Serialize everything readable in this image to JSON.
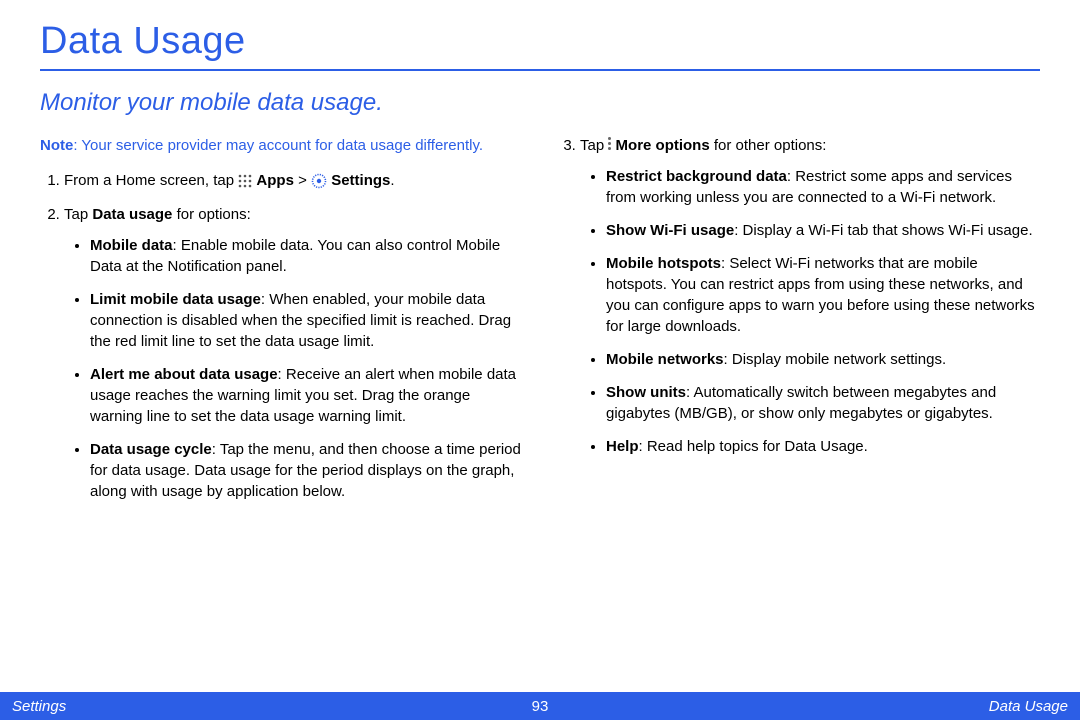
{
  "title": "Data Usage",
  "subtitle": "Monitor your mobile data usage.",
  "note_label": "Note",
  "note_text": ": Your service provider may account for data usage differently.",
  "step1_pre": "From a Home screen, tap ",
  "step1_apps": "Apps",
  "step1_gt": " > ",
  "step1_settings": "Settings",
  "step1_end": ".",
  "step2_pre": "Tap ",
  "step2_bold": "Data usage",
  "step2_post": " for options:",
  "left_items": [
    {
      "bold": "Mobile data",
      "rest": ": Enable mobile data. You can also control Mobile Data at the Notification panel."
    },
    {
      "bold": "Limit mobile data usage",
      "rest": ": When enabled, your mobile data connection is disabled when the specified limit is reached. Drag the red limit line to set the data usage limit."
    },
    {
      "bold": "Alert me about data usage",
      "rest": ": Receive an alert when mobile data usage reaches the warning limit you set. Drag the orange warning line to set the data usage warning limit."
    },
    {
      "bold": "Data usage cycle",
      "rest": ": Tap the menu, and then choose a time period for data usage. Data usage for the period displays on the graph, along with usage by application below."
    }
  ],
  "step3_pre": "Tap ",
  "step3_bold": "More options",
  "step3_post": " for other options:",
  "right_items": [
    {
      "bold": "Restrict background data",
      "rest": ": Restrict some apps and services from working unless you are connected to a Wi-Fi network."
    },
    {
      "bold": "Show Wi-Fi usage",
      "rest": ": Display a Wi-Fi tab that shows Wi-Fi usage."
    },
    {
      "bold": "Mobile hotspots",
      "rest": ": Select Wi-Fi networks that are mobile hotspots. You can restrict apps from using these networks, and you can configure apps to warn you before using these networks for large downloads."
    },
    {
      "bold": "Mobile networks",
      "rest": ": Display mobile network settings."
    },
    {
      "bold": "Show units",
      "rest": ": Automatically switch between megabytes and gigabytes (MB/GB), or show only megabytes or gigabytes."
    },
    {
      "bold": "Help",
      "rest": ": Read help topics for Data Usage."
    }
  ],
  "footer": {
    "left": "Settings",
    "center": "93",
    "right": "Data Usage"
  }
}
